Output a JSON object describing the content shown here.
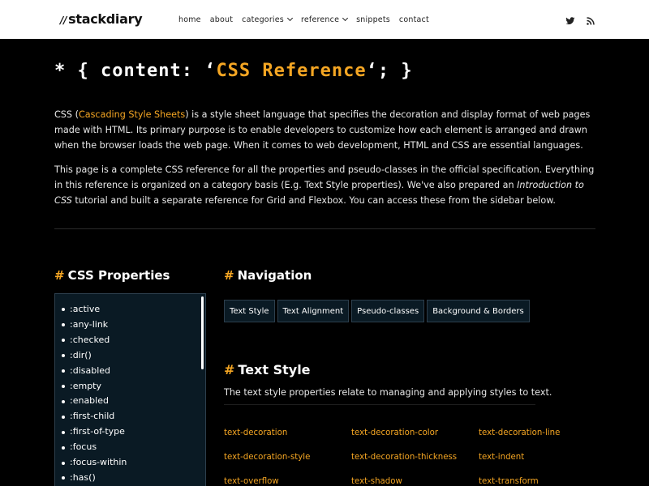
{
  "header": {
    "logo_slashes": "//",
    "logo_text": "stackdiary",
    "nav": [
      {
        "label": "home",
        "has_dropdown": false
      },
      {
        "label": "about",
        "has_dropdown": false
      },
      {
        "label": "categories",
        "has_dropdown": true
      },
      {
        "label": "reference",
        "has_dropdown": true
      },
      {
        "label": "snippets",
        "has_dropdown": false
      },
      {
        "label": "contact",
        "has_dropdown": false
      }
    ],
    "icons": [
      "twitter-icon",
      "rss-icon"
    ]
  },
  "hero": {
    "prefix": "* { content: ‘",
    "accent": "CSS Reference",
    "suffix": "‘; }"
  },
  "intro": {
    "p1_before": "CSS (",
    "p1_link": "Cascading Style Sheets",
    "p1_after": ") is a style sheet language that specifies the decoration and display format of web pages made with HTML. Its primary purpose is to enable developers to customize how each element is arranged and drawn when the browser loads the web page. When it comes to web development, HTML and CSS are essential languages.",
    "p2_before": "This page is a complete CSS reference for all the properties and pseudo-classes in the official specification. Everything in this reference is organized on a category basis (E.g. Text Style properties). We've also prepared an ",
    "p2_em": "Introduction to CSS",
    "p2_after": " tutorial and built a separate reference for Grid and Flexbox. You can access these from the sidebar below."
  },
  "sidebar": {
    "hash": "#",
    "heading": "CSS Properties",
    "items": [
      ":active",
      ":any-link",
      ":checked",
      ":dir()",
      ":disabled",
      ":empty",
      ":enabled",
      ":first-child",
      ":first-of-type",
      ":focus",
      ":focus-within",
      ":has()"
    ]
  },
  "navigation": {
    "hash": "#",
    "heading": "Navigation",
    "pills": [
      "Text Style",
      "Text Alignment",
      "Pseudo-classes",
      "Background & Borders"
    ]
  },
  "text_style": {
    "hash": "#",
    "heading": "Text Style",
    "description": "The text style properties relate to managing and applying styles to text.",
    "links": [
      "text-decoration",
      "text-decoration-color",
      "text-decoration-line",
      "text-decoration-style",
      "text-decoration-thickness",
      "text-indent",
      "text-overflow",
      "text-shadow",
      "text-transform"
    ]
  },
  "colors": {
    "accent": "#f5a623",
    "background": "#000000",
    "panel": "#0a1a24",
    "panel_border": "#2d3f4d"
  }
}
